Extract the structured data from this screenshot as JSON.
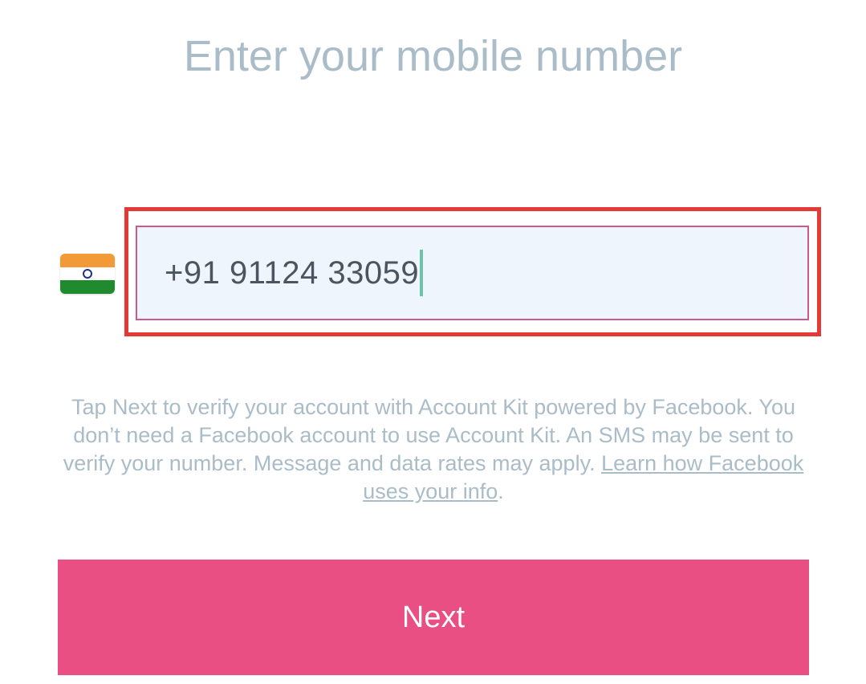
{
  "header": {
    "title": "Enter your mobile number"
  },
  "phone": {
    "country_flag": "india-flag",
    "value": "+91 91124 33059"
  },
  "disclaimer": {
    "text": "Tap Next to verify your account with Account Kit powered by Facebook. You don’t need a Facebook account to use Account Kit. An SMS may be sent to verify your number. Message and data rates may apply. ",
    "link_label": "Learn how Facebook uses your info",
    "suffix": "."
  },
  "actions": {
    "next_label": "Next"
  },
  "colors": {
    "accent": "#e94f83",
    "highlight": "#e53935",
    "input_bg": "#eef5fd",
    "muted_text": "#a9bcc8",
    "caret": "#6cc3a8"
  }
}
